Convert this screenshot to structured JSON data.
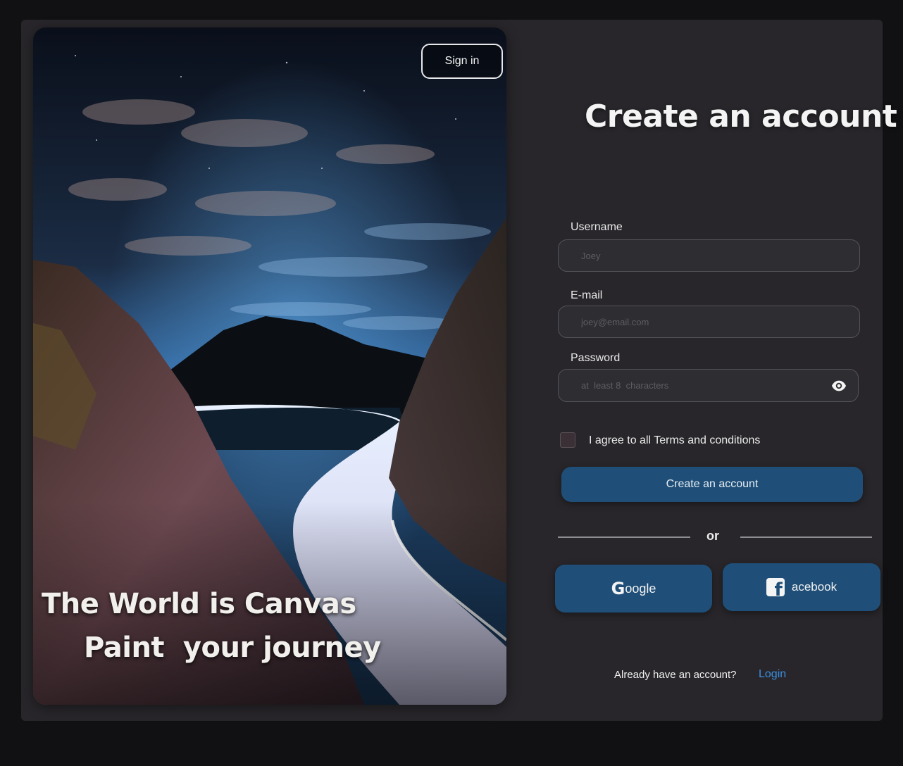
{
  "hero": {
    "sign_in_label": "Sign in",
    "tagline_line1": "The World is Canvas",
    "tagline_line2": "Paint  your journey"
  },
  "form": {
    "title": "Create an account",
    "username": {
      "label": "Username",
      "placeholder": "Joey"
    },
    "email": {
      "label": "E-mail",
      "placeholder": "joey@email.com"
    },
    "password": {
      "label": "Password",
      "placeholder": "at  least 8  characters",
      "toggle_icon": "eye-icon"
    },
    "terms_label": "I agree to all Terms and conditions",
    "terms_checked": false,
    "submit_label": "Create an account",
    "divider_label": "or",
    "google": {
      "g_letter": "G",
      "rest": "oogle"
    },
    "facebook": {
      "icon": "facebook-icon",
      "label": "acebook"
    },
    "already_text": "Already have an account?",
    "login_label": "Login"
  },
  "colors": {
    "background": "#111113",
    "card": "#28262a",
    "accent": "#1f4f78",
    "link": "#3b8fe0"
  }
}
